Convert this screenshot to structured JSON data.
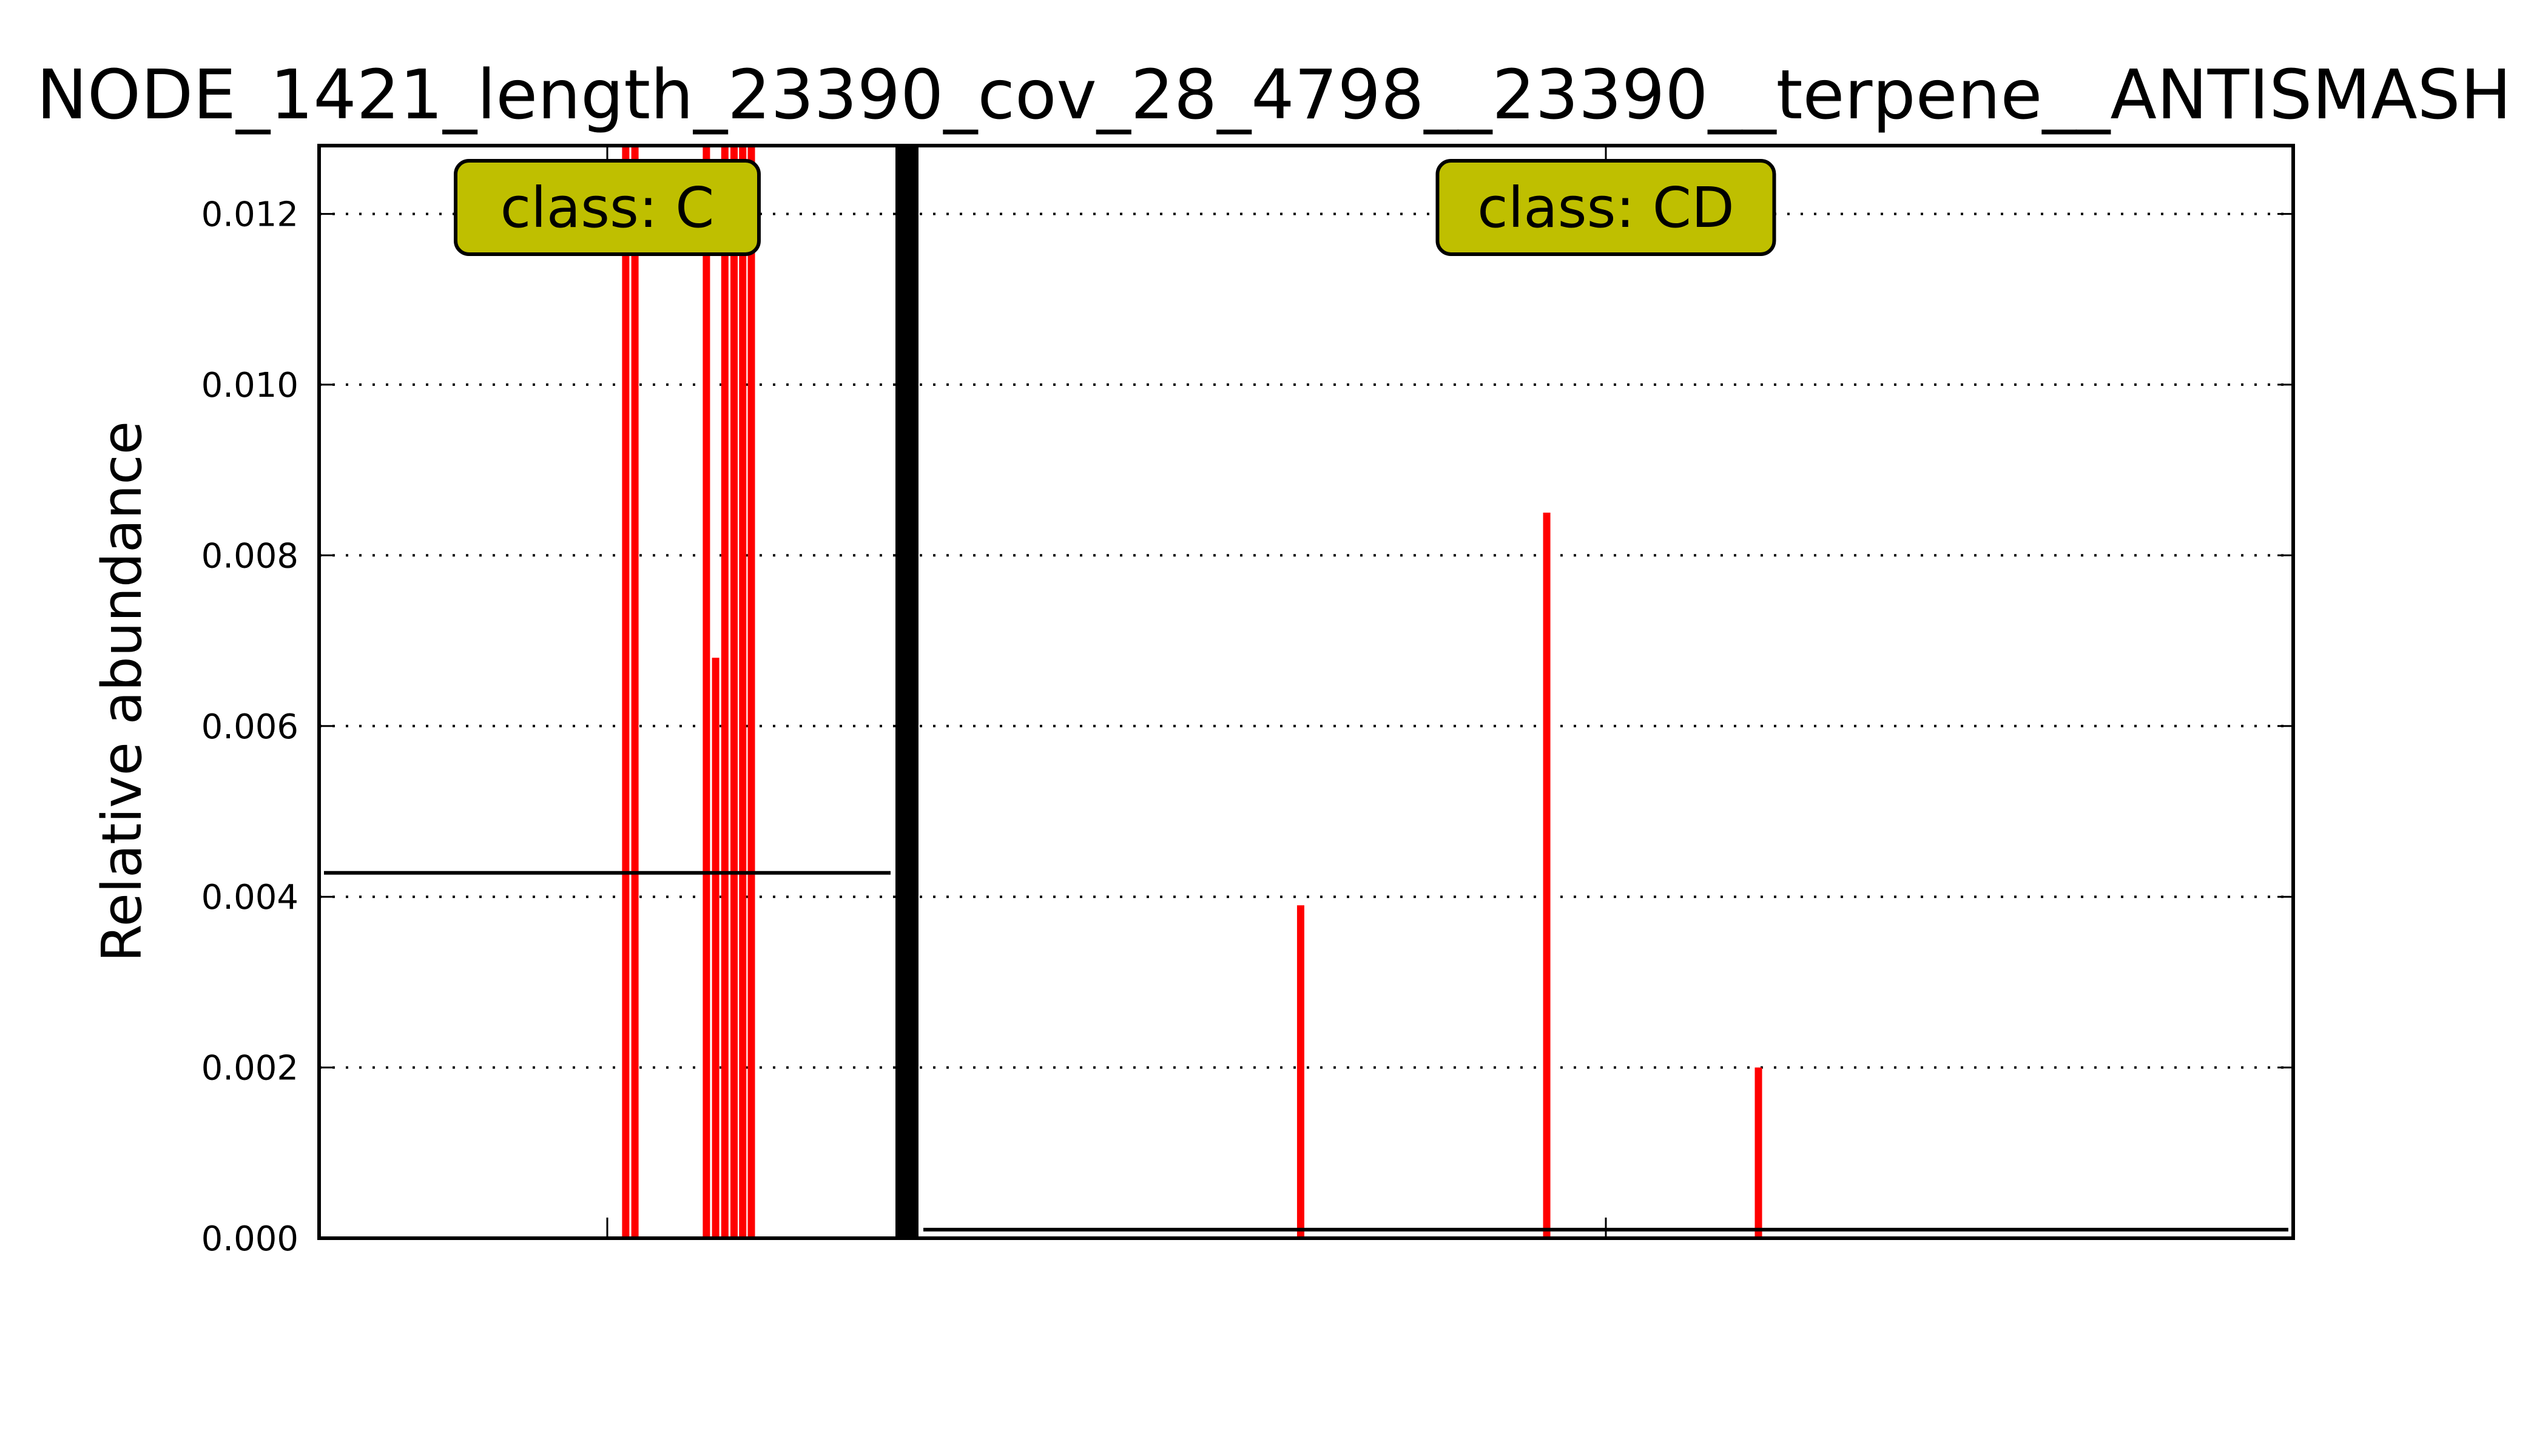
{
  "chart_data": {
    "type": "bar",
    "title": "NODE_1421_length_23390_cov_28_4798__23390__terpene__ANTISMASH",
    "xlabel": "",
    "ylabel": "Relative abundance",
    "ylim": [
      0,
      0.0128
    ],
    "yticks": [
      "0.000",
      "0.002",
      "0.004",
      "0.006",
      "0.008",
      "0.010",
      "0.012"
    ],
    "grid": "horizontal dotted",
    "bar_color": "#ff0000",
    "panels": [
      {
        "class_label": "class: C",
        "mean_line": 0.00428,
        "bars": [
          {
            "x": 0.532,
            "value": 0.0128
          },
          {
            "x": 0.548,
            "value": 0.0128
          },
          {
            "x": 0.672,
            "value": 0.0128
          },
          {
            "x": 0.688,
            "value": 0.0068
          },
          {
            "x": 0.704,
            "value": 0.0128
          },
          {
            "x": 0.72,
            "value": 0.0128
          },
          {
            "x": 0.735,
            "value": 0.0128
          },
          {
            "x": 0.75,
            "value": 0.0128
          }
        ]
      },
      {
        "class_label": "class: CD",
        "mean_line": 0.0001,
        "bars": [
          {
            "x": 0.278,
            "value": 0.0039
          },
          {
            "x": 0.457,
            "value": 0.0085
          },
          {
            "x": 0.611,
            "value": 0.002
          }
        ]
      }
    ]
  }
}
